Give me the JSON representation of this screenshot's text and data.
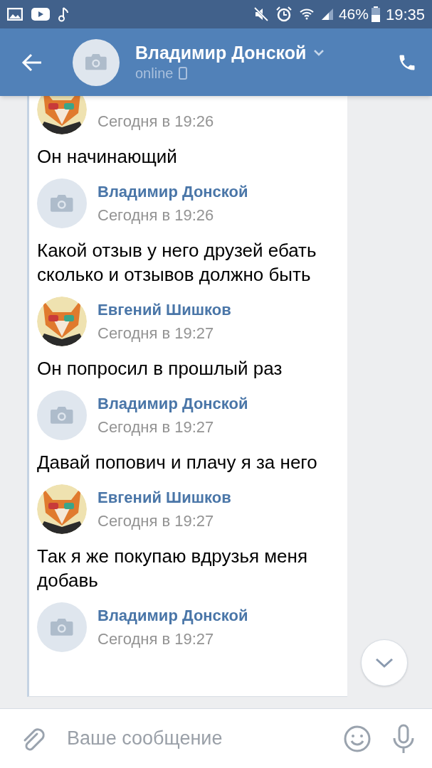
{
  "status_bar": {
    "battery": "46%",
    "time": "19:35"
  },
  "header": {
    "title": "Владимир Донской",
    "status": "online"
  },
  "messages": [
    {
      "kind": "picture",
      "time": "Сегодня в 19:26",
      "text": "Он начинающий"
    },
    {
      "kind": "camera",
      "author": "Владимир Донской",
      "time": "Сегодня в 19:26",
      "text": "Какой отзыв у него друзей ебать сколько и отзывов должно быть"
    },
    {
      "kind": "picture",
      "author": "Евгений Шишков",
      "time": "Сегодня в 19:27",
      "text": "Он попросил в прошлый раз"
    },
    {
      "kind": "camera",
      "author": "Владимир Донской",
      "time": "Сегодня в 19:27",
      "text": "Давай попович и  плачу я за него"
    },
    {
      "kind": "picture",
      "author": "Евгений Шишков",
      "time": "Сегодня в 19:27",
      "text": "Так я же покупаю вдрузья меня добавь"
    },
    {
      "kind": "camera",
      "author": "Владимир Донской",
      "time": "Сегодня в 19:27"
    }
  ],
  "composer": {
    "placeholder": "Ваше сообщение"
  }
}
